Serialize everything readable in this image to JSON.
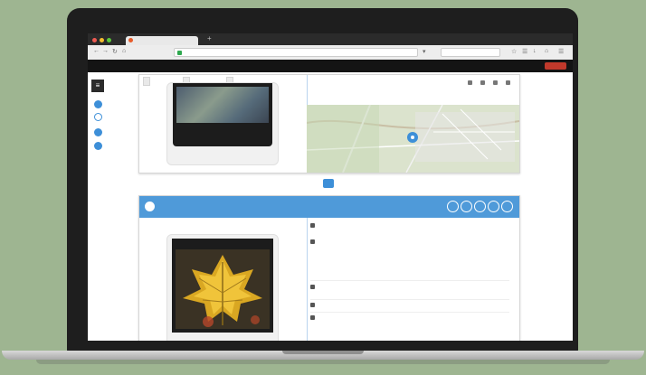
{
  "browser": {
    "tab_title": "",
    "url": "",
    "search_placeholder": ""
  },
  "app": {
    "brand": "",
    "header_links": [
      "",
      "",
      ""
    ]
  },
  "card1": {
    "toolbar_buttons": [
      "",
      "",
      ""
    ],
    "photo_caption": "",
    "photo_footer": "",
    "map_label": ""
  },
  "card2": {
    "header_title": "",
    "leaf_caption": "",
    "meta": {
      "row1_title": "",
      "row1_sub": "",
      "row2_title": "",
      "row2_items": [
        "",
        "",
        "",
        ""
      ],
      "row3_title": "",
      "row3_value": "",
      "row4_text": "",
      "row5_text": ""
    }
  },
  "colors": {
    "brand": "#e66a2c",
    "accent_blue": "#4f9ad9",
    "header_bg": "#141414",
    "background": "#9eb591"
  }
}
